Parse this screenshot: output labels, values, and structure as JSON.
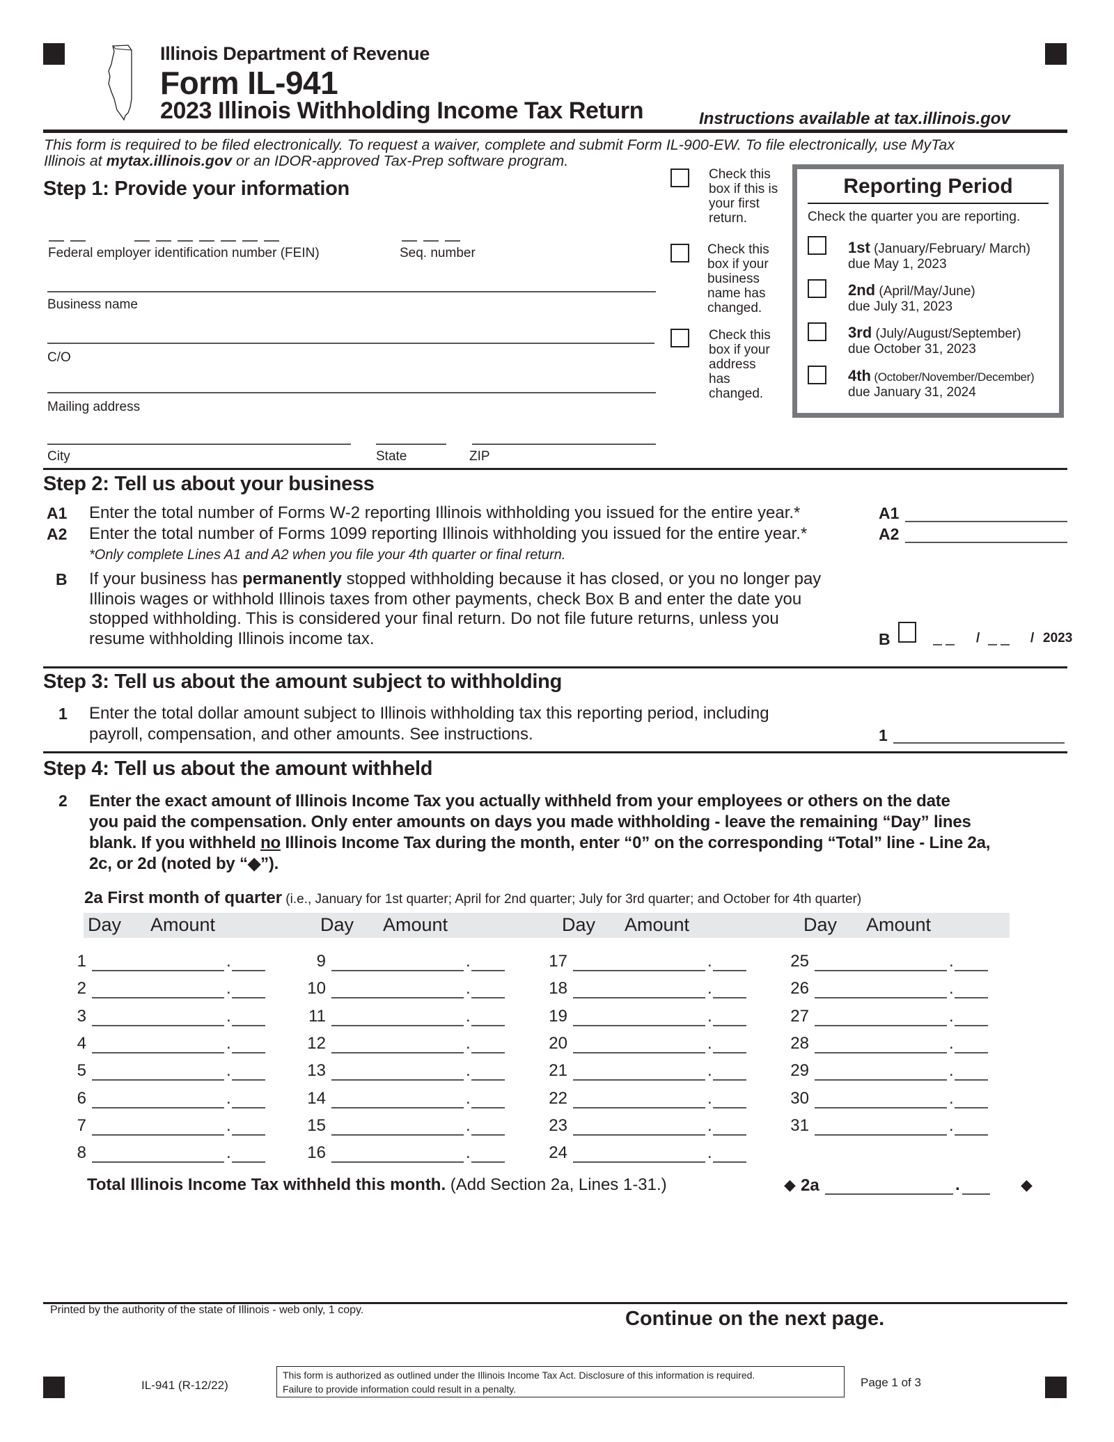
{
  "header": {
    "department": "Illinois Department of Revenue",
    "form_name": "Form IL-941",
    "form_title": "2023 Illinois Withholding Income Tax Return",
    "instructions_note": "Instructions available at tax.illinois.gov"
  },
  "intro": {
    "line1": "This form is required to be filed electronically. To request a waiver, complete and submit Form IL-900-EW.  To file electronically, use MyTax",
    "line2_prefix": "Illinois at ",
    "line2_link": "mytax.illinois.gov",
    "line2_suffix": " or an IDOR-approved Tax-Prep software program."
  },
  "step1": {
    "heading": "Step 1:  Provide your information",
    "fein_label": "Federal employer identification number (FEIN)",
    "seq_label": "Seq. number",
    "business_name_label": "Business name",
    "co_label": "C/O",
    "mailing_address_label": "Mailing address",
    "city_label": "City",
    "state_label": "State",
    "zip_label": "ZIP",
    "fein_value": "",
    "seq_value": "",
    "business_name_value": "",
    "co_value": "",
    "mailing_address_value": "",
    "city_value": "",
    "state_value": "",
    "zip_value": ""
  },
  "checkboxes": [
    {
      "lines": [
        "Check this",
        "box if this is",
        "your first",
        "return."
      ],
      "checked": false
    },
    {
      "lines": [
        "Check this",
        "box if your",
        "business",
        "name has",
        "changed."
      ],
      "checked": false
    },
    {
      "lines": [
        "Check this",
        "box if your",
        "address",
        "has",
        "changed."
      ],
      "checked": false
    }
  ],
  "reporting_period": {
    "title": "Reporting Period",
    "instruction": "Check the quarter you are reporting.",
    "quarters": [
      {
        "label": "1st",
        "months": " (January/February/ March)",
        "due": " due May 1, 2023",
        "checked": false
      },
      {
        "label": "2nd",
        "months": " (April/May/June)",
        "due": " due July 31, 2023",
        "checked": false
      },
      {
        "label": "3rd",
        "months": " (July/August/September)",
        "due": " due October 31, 2023",
        "checked": false
      },
      {
        "label": "4th",
        "months": " (October/November/December)",
        "due": "due January 31, 2024",
        "checked": false
      }
    ]
  },
  "step2": {
    "heading": "Step 2:  Tell us about your business",
    "a1_code": "A1",
    "a1_text": "Enter the total number of Forms W-2 reporting Illinois withholding you issued for the entire year.*",
    "a1_value": "",
    "a2_code": "A2",
    "a2_text": "Enter the total number of Forms 1099 reporting Illinois withholding you issued for the entire year.*",
    "a2_value": "",
    "footnote": "*Only complete Lines A1 and A2 when you file your 4th quarter or final return.",
    "b_code": "B",
    "b_text_pre": "If your business has ",
    "b_text_bold": "permanently",
    "b_text_post": " stopped withholding because it has closed, or you no longer pay Illinois wages or withhold Illinois taxes from other payments, check Box B and enter the date you stopped withholding. This is considered your final return. Do not file future returns, unless you resume withholding Illinois income tax.",
    "b_date_sep": "/",
    "b_year": "2023",
    "b_checked": false
  },
  "step3": {
    "heading": "Step 3:  Tell us about the amount subject to withholding",
    "line1_code": "1",
    "line1_text_a": "Enter the total dollar amount subject to Illinois withholding tax this reporting period, including",
    "line1_text_b": "payroll, compensation, and other amounts. See instructions.",
    "line1_value": ""
  },
  "step4": {
    "heading": "Step 4:  Tell us about the amount withheld",
    "line2_code": "2",
    "line2_text_a": "Enter the exact amount of Illinois Income Tax you actually withheld from your employees or others on the date",
    "line2_text_b": "you paid the compensation.  Only enter amounts on days you made withholding - leave the remaining “Day” lines",
    "line2_text_c_pre": "blank. If you withheld ",
    "line2_text_c_u": "no",
    "line2_text_c_post": " Illinois Income Tax during the month, enter “0” on the corresponding “Total” line - Line 2a,",
    "line2_text_d": "2c, or 2d (noted by “◆”).",
    "section_2a_label": "2a  First month of quarter",
    "section_2a_note": " (i.e., January for 1st quarter; April for 2nd quarter; July for 3rd quarter; and October for 4th quarter)",
    "col_day": "Day",
    "col_amount": "Amount",
    "days": [
      "1",
      "2",
      "3",
      "4",
      "5",
      "6",
      "7",
      "8",
      "9",
      "10",
      "11",
      "12",
      "13",
      "14",
      "15",
      "16",
      "17",
      "18",
      "19",
      "20",
      "21",
      "22",
      "23",
      "24",
      "25",
      "26",
      "27",
      "28",
      "29",
      "30",
      "31"
    ],
    "total_label_bold": "Total Illinois Income Tax withheld this month.",
    "total_label_rest": " (Add Section 2a, Lines 1-31.)",
    "total_code": "2a",
    "total_value": "",
    "diamond_glyph": "◆"
  },
  "footer": {
    "printed_by": "Printed by the authority of the state of Illinois - web only, 1 copy.",
    "continue": "Continue on the next page.",
    "form_rev": "IL-941 (R-12/22)",
    "auth_line1": "This form is authorized as outlined under the Illinois Income Tax Act.  Disclosure of this information is required.",
    "auth_line2": "Failure to provide information could result in a penalty.",
    "page": "Page 1 of 3"
  }
}
